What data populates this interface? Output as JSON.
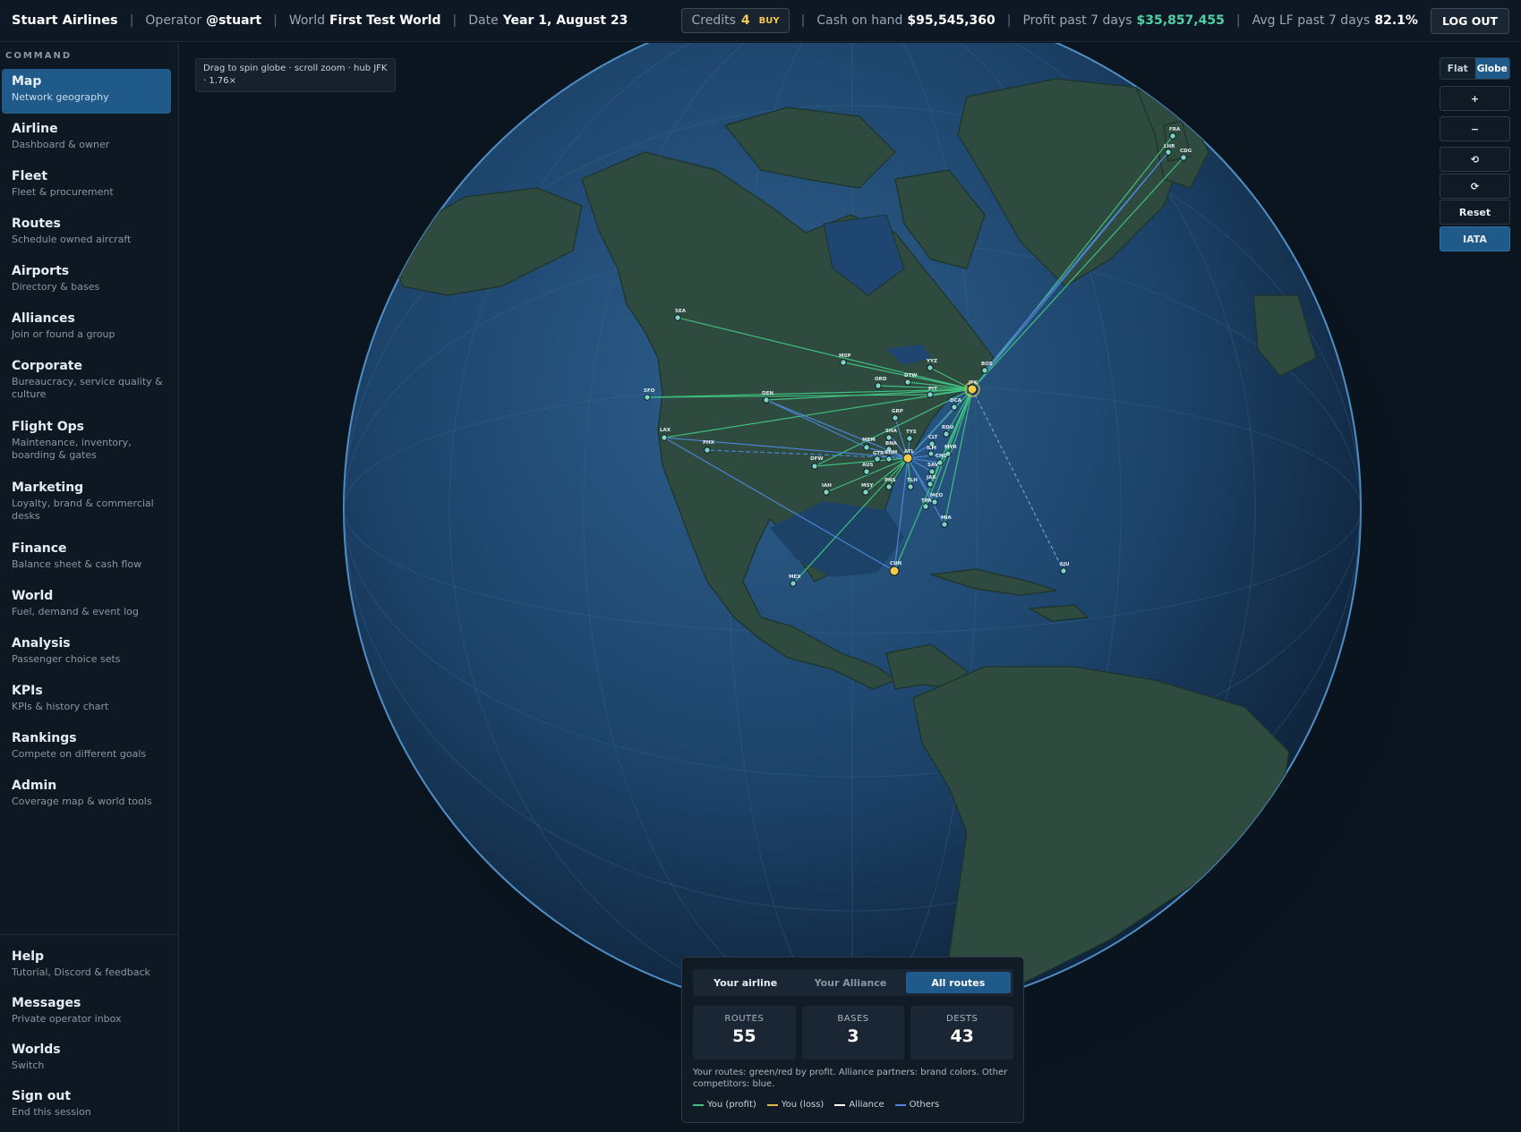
{
  "topbar": {
    "airline_name": "Stuart Airlines",
    "operator_label": "Operator",
    "operator_value": "@stuart",
    "world_label": "World",
    "world_value": "First Test World",
    "date_label": "Date",
    "date_value": "Year 1, August 23",
    "credits_label": "Credits",
    "credits_value": "4",
    "buy_label": "BUY",
    "cash_label": "Cash on hand",
    "cash_value": "$95,545,360",
    "profit_label": "Profit past 7 days",
    "profit_value": "$35,857,455",
    "lf_label": "Avg LF past 7 days",
    "lf_value": "82.1%",
    "logout_label": "LOG OUT"
  },
  "sidebar": {
    "section_title": "COMMAND",
    "items": [
      {
        "title": "Map",
        "subtitle": "Network geography"
      },
      {
        "title": "Airline",
        "subtitle": "Dashboard & owner"
      },
      {
        "title": "Fleet",
        "subtitle": "Fleet & procurement"
      },
      {
        "title": "Routes",
        "subtitle": "Schedule owned aircraft"
      },
      {
        "title": "Airports",
        "subtitle": "Directory & bases"
      },
      {
        "title": "Alliances",
        "subtitle": "Join or found a group"
      },
      {
        "title": "Corporate",
        "subtitle": "Bureaucracy, service quality & culture"
      },
      {
        "title": "Flight Ops",
        "subtitle": "Maintenance, inventory, boarding & gates"
      },
      {
        "title": "Marketing",
        "subtitle": "Loyalty, brand & commercial desks"
      },
      {
        "title": "Finance",
        "subtitle": "Balance sheet & cash flow"
      },
      {
        "title": "World",
        "subtitle": "Fuel, demand & event log"
      },
      {
        "title": "Analysis",
        "subtitle": "Passenger choice sets"
      },
      {
        "title": "KPIs",
        "subtitle": "KPIs & history chart"
      },
      {
        "title": "Rankings",
        "subtitle": "Compete on different goals"
      },
      {
        "title": "Admin",
        "subtitle": "Coverage map & world tools"
      }
    ],
    "bottom_items": [
      {
        "title": "Help",
        "subtitle": "Tutorial, Discord & feedback"
      },
      {
        "title": "Messages",
        "subtitle": "Private operator inbox"
      },
      {
        "title": "Worlds",
        "subtitle": "Switch"
      },
      {
        "title": "Sign out",
        "subtitle": "End this session"
      }
    ]
  },
  "map": {
    "hint": "Drag to spin globe · scroll zoom · hub JFK · 1.76×",
    "view_flat": "Flat",
    "view_globe": "Globe",
    "zoom_in": "+",
    "zoom_out": "−",
    "rotate_left": "⟲",
    "rotate_right": "⟳",
    "reset": "Reset",
    "iata": "IATA",
    "airports": [
      "SEA",
      "SFO",
      "LAX",
      "PHX",
      "DEN",
      "MSP",
      "ORD",
      "DTW",
      "YYZ",
      "PIT",
      "BOS",
      "JFK",
      "DCA",
      "GRP",
      "SHA",
      "MEM",
      "TYS",
      "BNA",
      "ATL",
      "CLT",
      "RDU",
      "MYR",
      "CHS",
      "SAV",
      "JAX",
      "DFW",
      "AUS",
      "IAH",
      "MSY",
      "PNS",
      "TLH",
      "MCO",
      "TPA",
      "MIA",
      "CUN",
      "MEX",
      "SJU",
      "FRA",
      "LHR",
      "CDG",
      "BHM",
      "GTR",
      "ILM"
    ],
    "colors": {
      "profit": "#3fbf7f",
      "loss": "#e0b84a",
      "alliance": "#ffffff",
      "others": "#4a86d4"
    }
  },
  "panel": {
    "tabs": [
      "Your airline",
      "Your Alliance",
      "All routes"
    ],
    "active_tab": "All routes",
    "stats": [
      {
        "label": "ROUTES",
        "value": "55"
      },
      {
        "label": "BASES",
        "value": "3"
      },
      {
        "label": "DESTS",
        "value": "43"
      }
    ],
    "note": "Your routes: green/red by profit. Alliance partners: brand colors. Other competitors: blue.",
    "legend": [
      "You (profit)",
      "You (loss)",
      "Alliance",
      "Others"
    ]
  }
}
